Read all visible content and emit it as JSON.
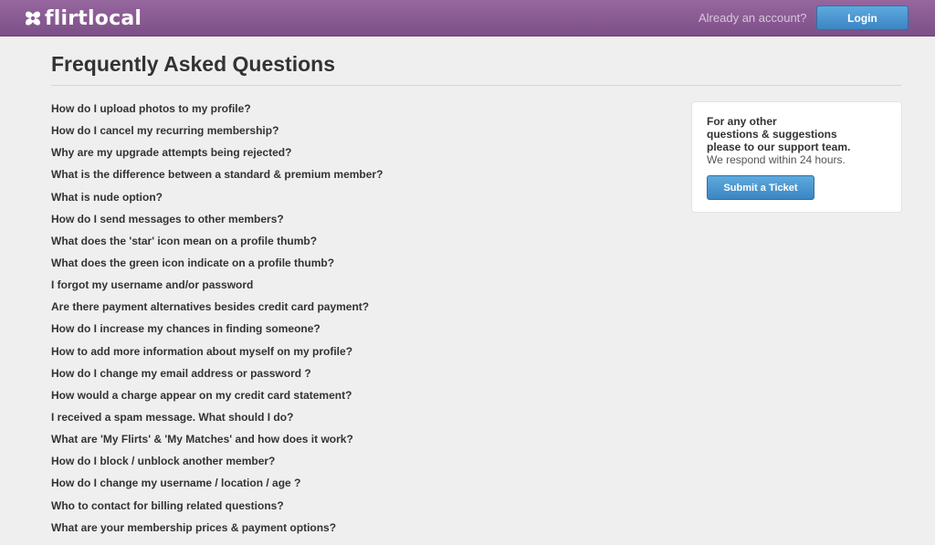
{
  "header": {
    "logo_text": "flirtlocal",
    "logo_icon": "heart-bow-icon",
    "account_prompt": "Already an account?",
    "login_label": "Login"
  },
  "main": {
    "title": "Frequently Asked Questions",
    "questions": [
      "How do I upload photos to my profile?",
      "How do I cancel my recurring membership?",
      "Why are my upgrade attempts being rejected?",
      "What is the difference between a standard & premium member?",
      "What is nude option?",
      "How do I send messages to other members?",
      "What does the 'star' icon mean on a profile thumb?",
      "What does the green icon indicate on a profile thumb?",
      "I forgot my username and/or password",
      "Are there payment alternatives besides credit card payment?",
      "How do I increase my chances in finding someone?",
      "How to add more information about myself on my profile?",
      "How do I change my email address or password ?",
      "How would a charge appear on my credit card statement?",
      "I received a spam message. What should I do?",
      "What are 'My Flirts' & 'My Matches' and how does it work?",
      "How do I block / unblock another member?",
      "How do I change my username / location / age ?",
      "Who to contact for billing related questions?",
      "What are your membership prices & payment options?"
    ]
  },
  "support": {
    "heading": [
      "For any other",
      "questions & suggestions",
      "please to our support team."
    ],
    "note": "We respond within 24 hours.",
    "button_label": "Submit a Ticket"
  },
  "colors": {
    "header_bg": "#8a5b94",
    "button_blue": "#4a95d0",
    "text_dark": "#333333",
    "page_bg": "#efefef"
  }
}
